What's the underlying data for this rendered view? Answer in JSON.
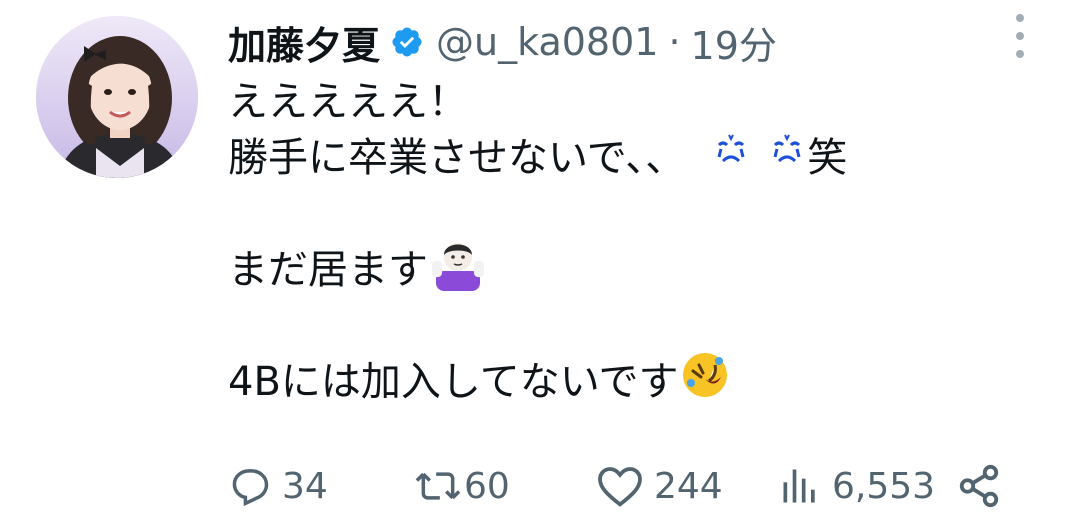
{
  "tweet": {
    "author": {
      "display_name": "加藤夕夏",
      "verified_icon": "verified-badge-icon",
      "handle": "@u_ka0801",
      "separator": "·",
      "time": "19分"
    },
    "text_lines": [
      "えええええ！",
      "勝手に卒業させないで、、",
      "",
      "まだ居ます",
      "",
      "4Bには加入してないです"
    ],
    "line2_suffix": "笑",
    "metrics": {
      "replies": "34",
      "retweets": "60",
      "likes": "244",
      "views": "6,553"
    },
    "icons": {
      "reply": "reply-icon",
      "retweet": "retweet-icon",
      "like": "heart-icon",
      "views": "views-chart-icon",
      "share": "share-icon",
      "more": "more-vertical-icon"
    },
    "colors": {
      "accent": "#1d9bf0",
      "secondary_text": "#536471",
      "primary_text": "#0f1419"
    }
  }
}
